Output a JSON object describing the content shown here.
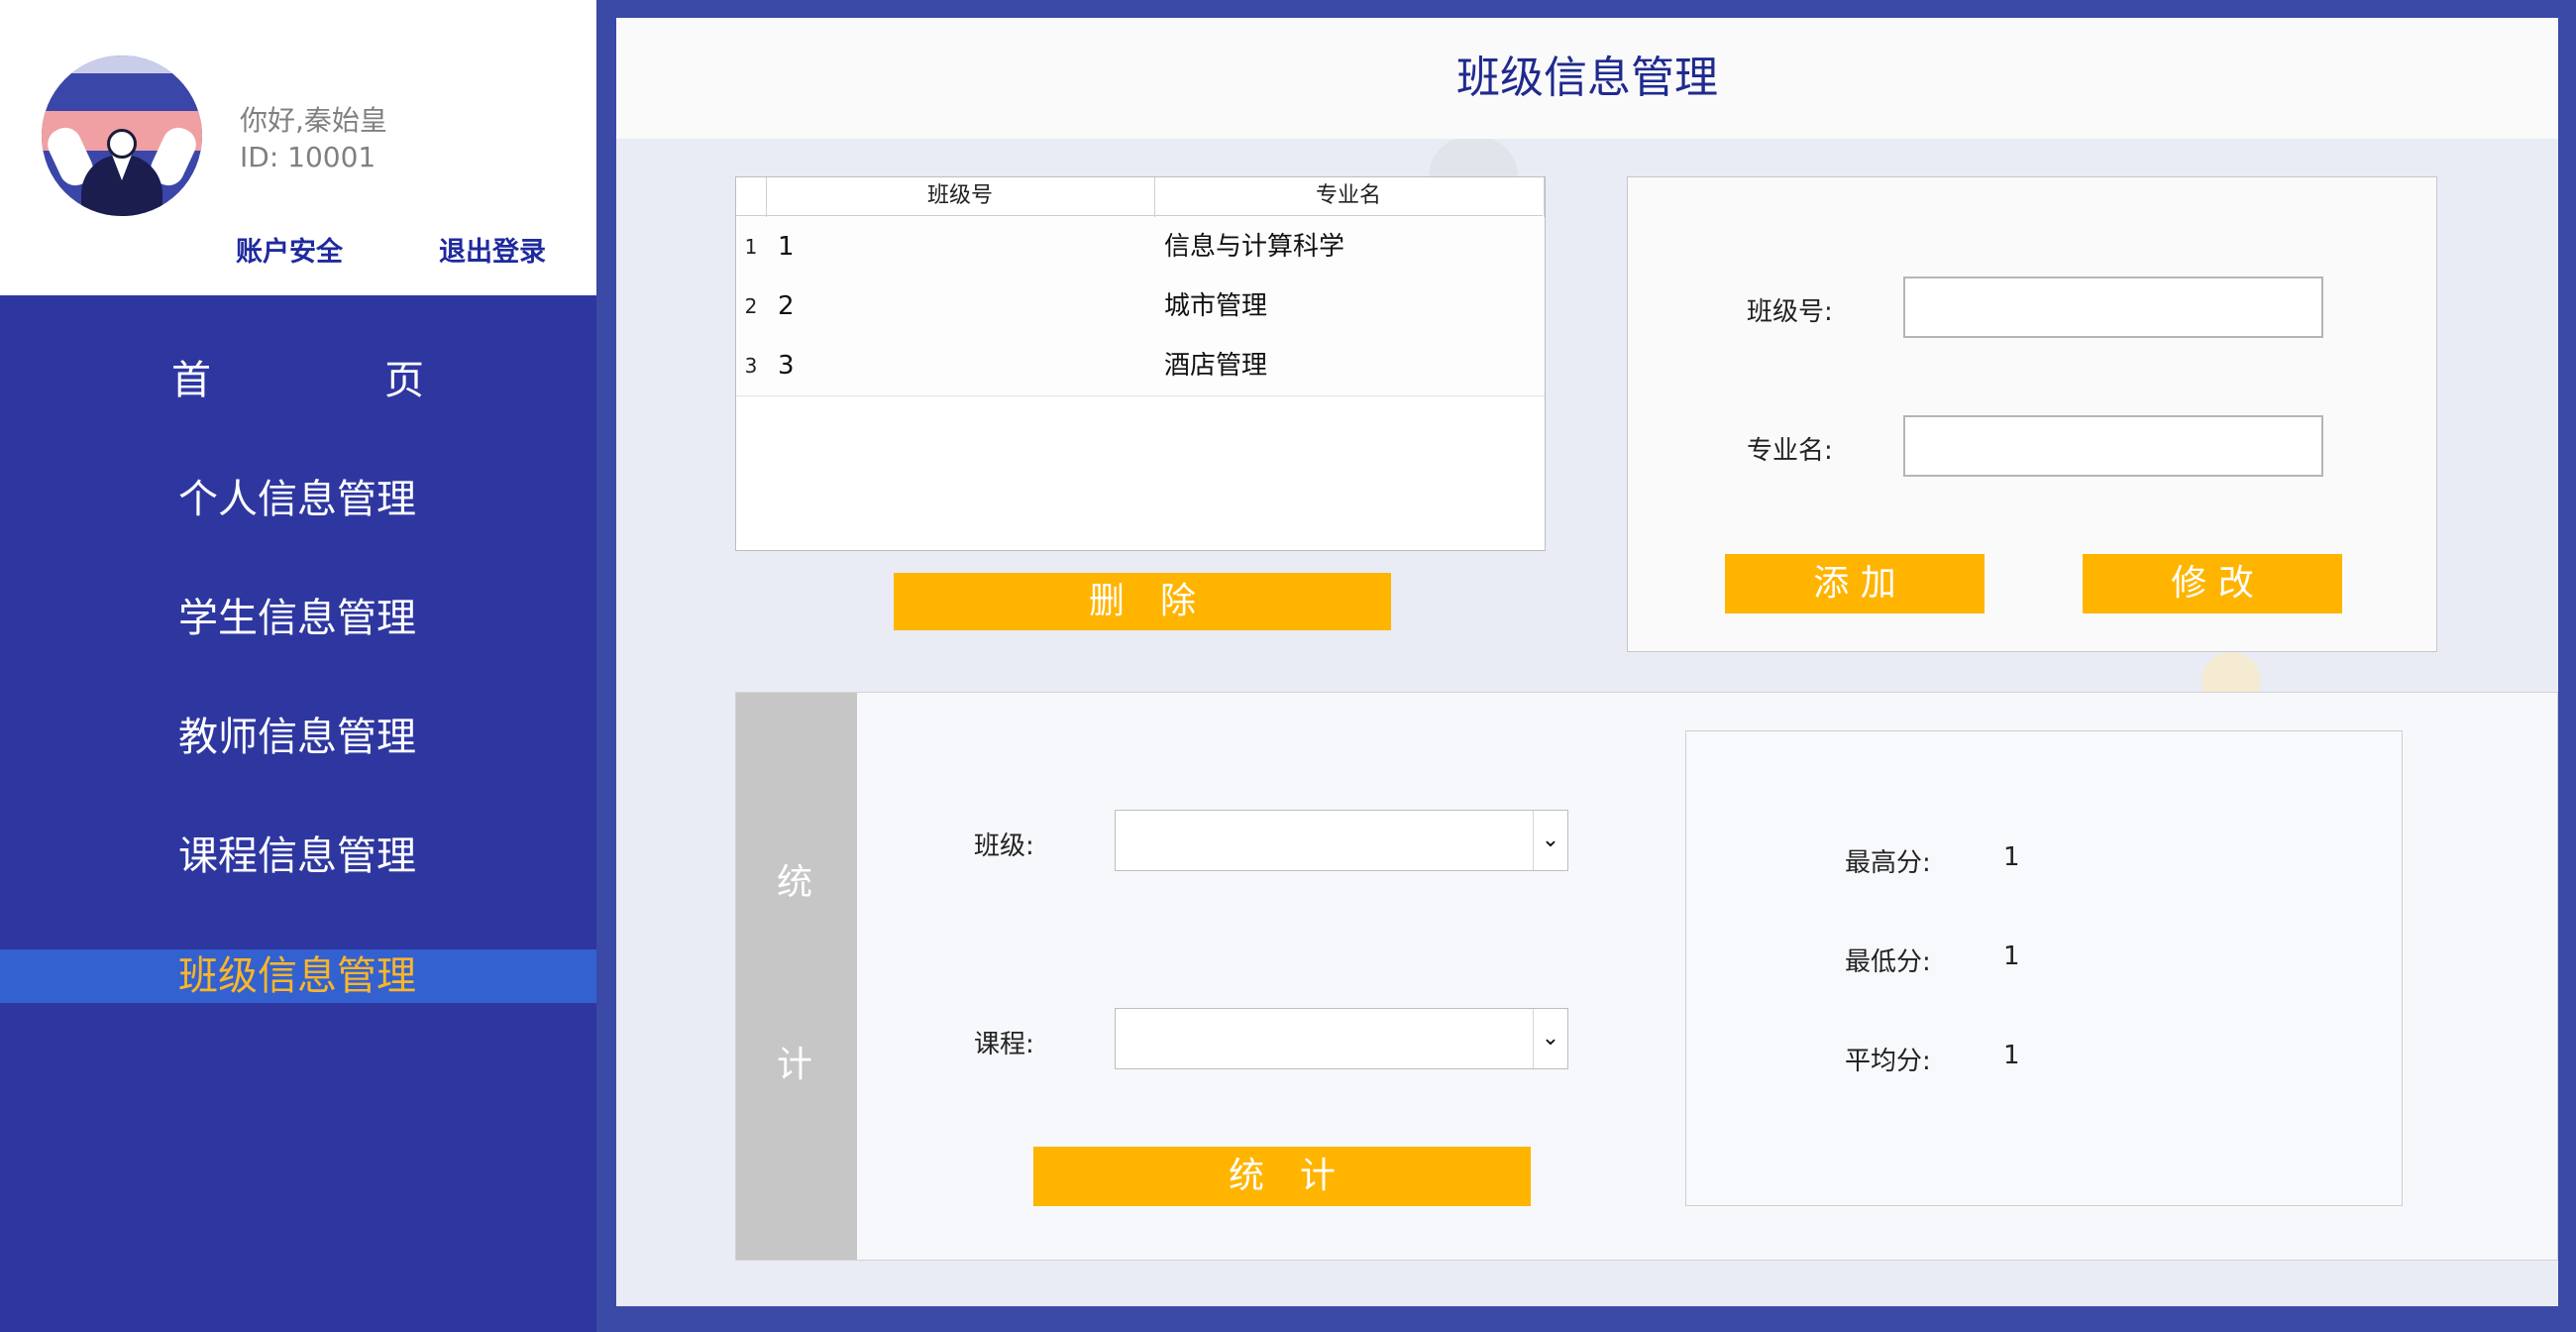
{
  "profile": {
    "greeting": "你好,秦始皇",
    "user_id": "ID: 10001",
    "security_link": "账户安全",
    "logout_link": "退出登录"
  },
  "nav": {
    "home_char1": "首",
    "home_char2": "页",
    "personal": "个人信息管理",
    "student": "学生信息管理",
    "teacher": "教师信息管理",
    "course": "课程信息管理",
    "class": "班级信息管理",
    "active": "班级信息管理"
  },
  "page": {
    "title": "班级信息管理"
  },
  "table": {
    "columns": [
      "班级号",
      "专业名"
    ],
    "rows": [
      {
        "index": "1",
        "class_id": "1",
        "major": "信息与计算科学"
      },
      {
        "index": "2",
        "class_id": "2",
        "major": "城市管理"
      },
      {
        "index": "3",
        "class_id": "3",
        "major": "酒店管理"
      }
    ]
  },
  "actions": {
    "delete": "删　除",
    "add": "添 加",
    "modify": "修 改",
    "stat": "统　计"
  },
  "form": {
    "class_id_label": "班级号:",
    "class_id_value": "",
    "major_label": "专业名:",
    "major_value": ""
  },
  "stats": {
    "side_char1": "统",
    "side_char2": "计",
    "class_label": "班级:",
    "class_value": "",
    "course_label": "课程:",
    "course_value": "",
    "max_label": "最高分:",
    "max_value": "1",
    "min_label": "最低分:",
    "min_value": "1",
    "avg_label": "平均分:",
    "avg_value": "1"
  },
  "colors": {
    "sidebar": "#2e37a0",
    "active_nav_bg": "#3461d0",
    "active_nav_text": "#f7b62a",
    "button": "#ffb400",
    "title": "#1f2a8e"
  }
}
